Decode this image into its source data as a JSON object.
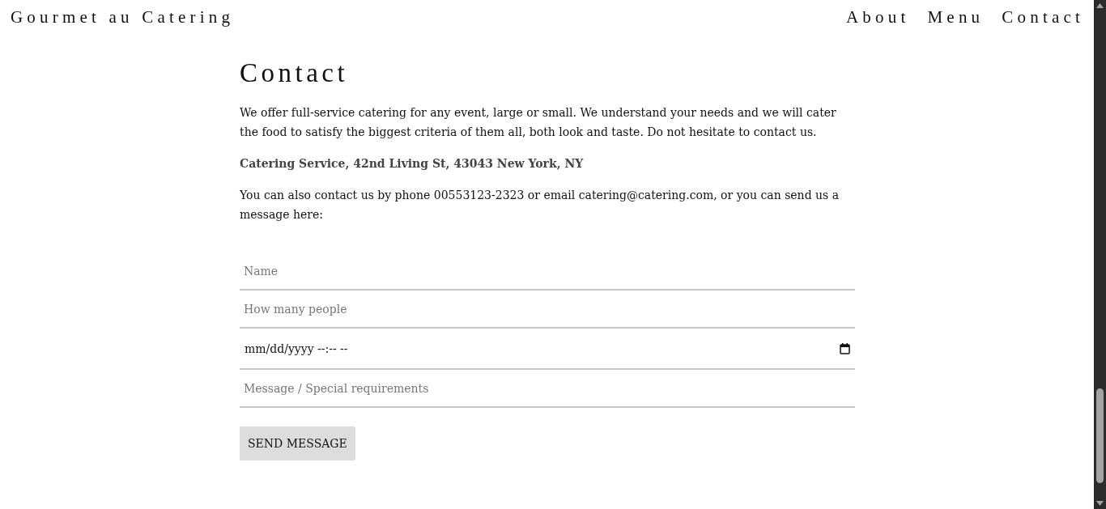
{
  "header": {
    "brand": "Gourmet au Catering",
    "nav": [
      {
        "label": "About"
      },
      {
        "label": "Menu"
      },
      {
        "label": "Contact"
      }
    ]
  },
  "contact": {
    "title": "Contact",
    "intro": "We offer full-service catering for any event, large or small. We understand your needs and we will cater the food to satisfy the biggest criteria of them all, both look and taste. Do not hesitate to contact us.",
    "address": "Catering Service, 42nd Living St, 43043 New York, NY",
    "note": "You can also contact us by phone 00553123-2323 or email catering@catering.com, or you can send us a message here:"
  },
  "form": {
    "fields": [
      {
        "kind": "text",
        "placeholder": "Name"
      },
      {
        "kind": "text",
        "placeholder": "How many people"
      },
      {
        "kind": "datetime",
        "value": "mm/dd/yyyy --:-- --"
      },
      {
        "kind": "text",
        "placeholder": "Message / Special requirements"
      }
    ],
    "button": "SEND MESSAGE"
  }
}
